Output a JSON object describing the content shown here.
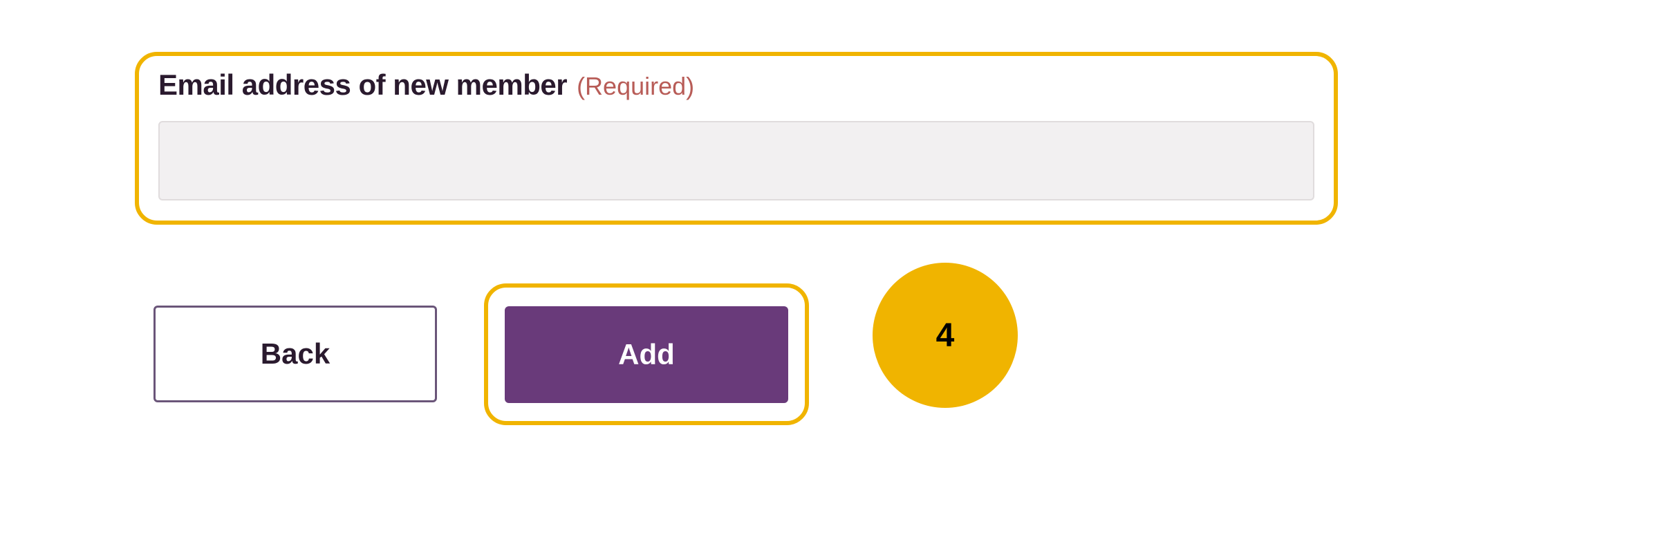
{
  "form": {
    "email": {
      "label": "Email address of new member",
      "required_tag": "(Required)",
      "value": ""
    }
  },
  "buttons": {
    "back": "Back",
    "add": "Add"
  },
  "annotation": {
    "step_number": "4"
  }
}
